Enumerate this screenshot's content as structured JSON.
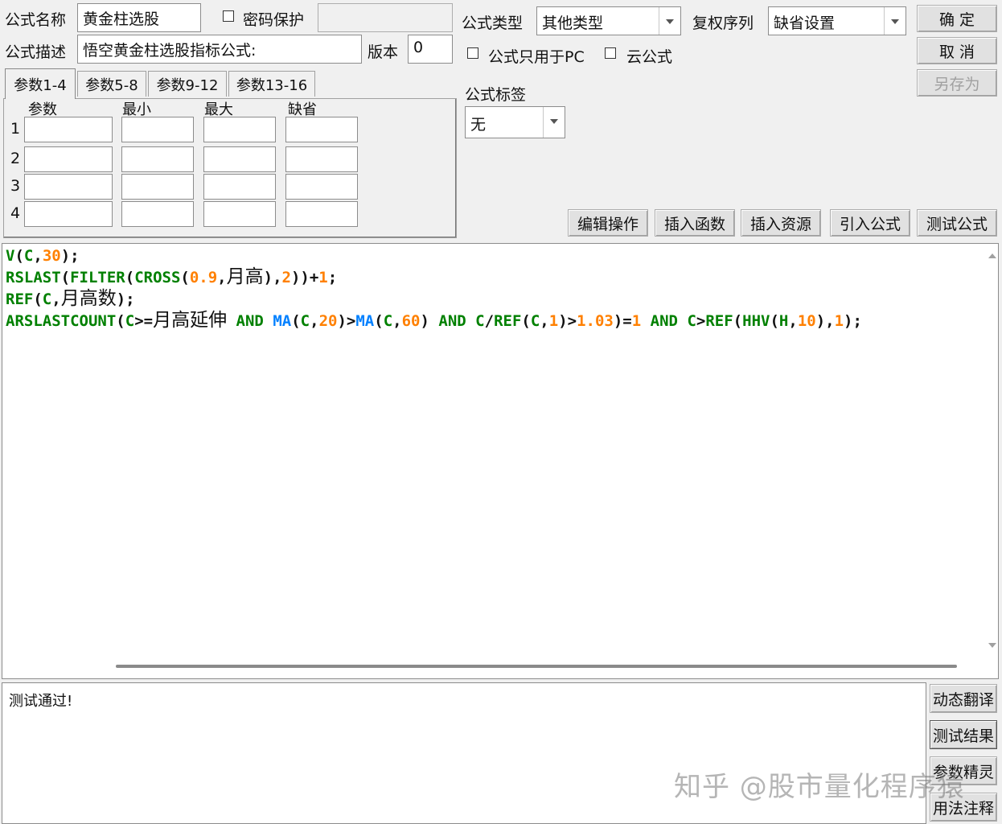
{
  "header": {
    "name_label": "公式名称",
    "name_value": "黄金柱选股",
    "password_label": "密码保护",
    "password_value": "",
    "desc_label": "公式描述",
    "desc_value": "悟空黄金柱选股指标公式:",
    "version_label": "版本",
    "version_value": "0",
    "type_label": "公式类型",
    "type_value": "其他类型",
    "rights_label": "复权序列",
    "rights_value": "缺省设置",
    "pc_only_label": "公式只用于PC",
    "cloud_label": "云公式",
    "tag_label": "公式标签",
    "tag_value": "无"
  },
  "buttons": {
    "ok": "确  定",
    "cancel": "取  消",
    "save_as": "另存为",
    "edit_ops": "编辑操作",
    "insert_func": "插入函数",
    "insert_res": "插入资源",
    "import_formula": "引入公式",
    "test_formula": "测试公式",
    "dyn_translate": "动态翻译",
    "test_result": "测试结果",
    "param_wizard": "参数精灵",
    "usage_notes": "用法注释"
  },
  "params": {
    "tabs": [
      "参数1-4",
      "参数5-8",
      "参数9-12",
      "参数13-16"
    ],
    "columns": [
      "参数",
      "最小",
      "最大",
      "缺省"
    ],
    "rows": [
      "1",
      "2",
      "3",
      "4"
    ]
  },
  "colors": {
    "func_green": "#008000",
    "num_orange": "#ff8000",
    "func_blue": "#0080ff"
  },
  "output": {
    "text": "测试通过!"
  },
  "watermark": "知乎 @股市量化程序猿"
}
